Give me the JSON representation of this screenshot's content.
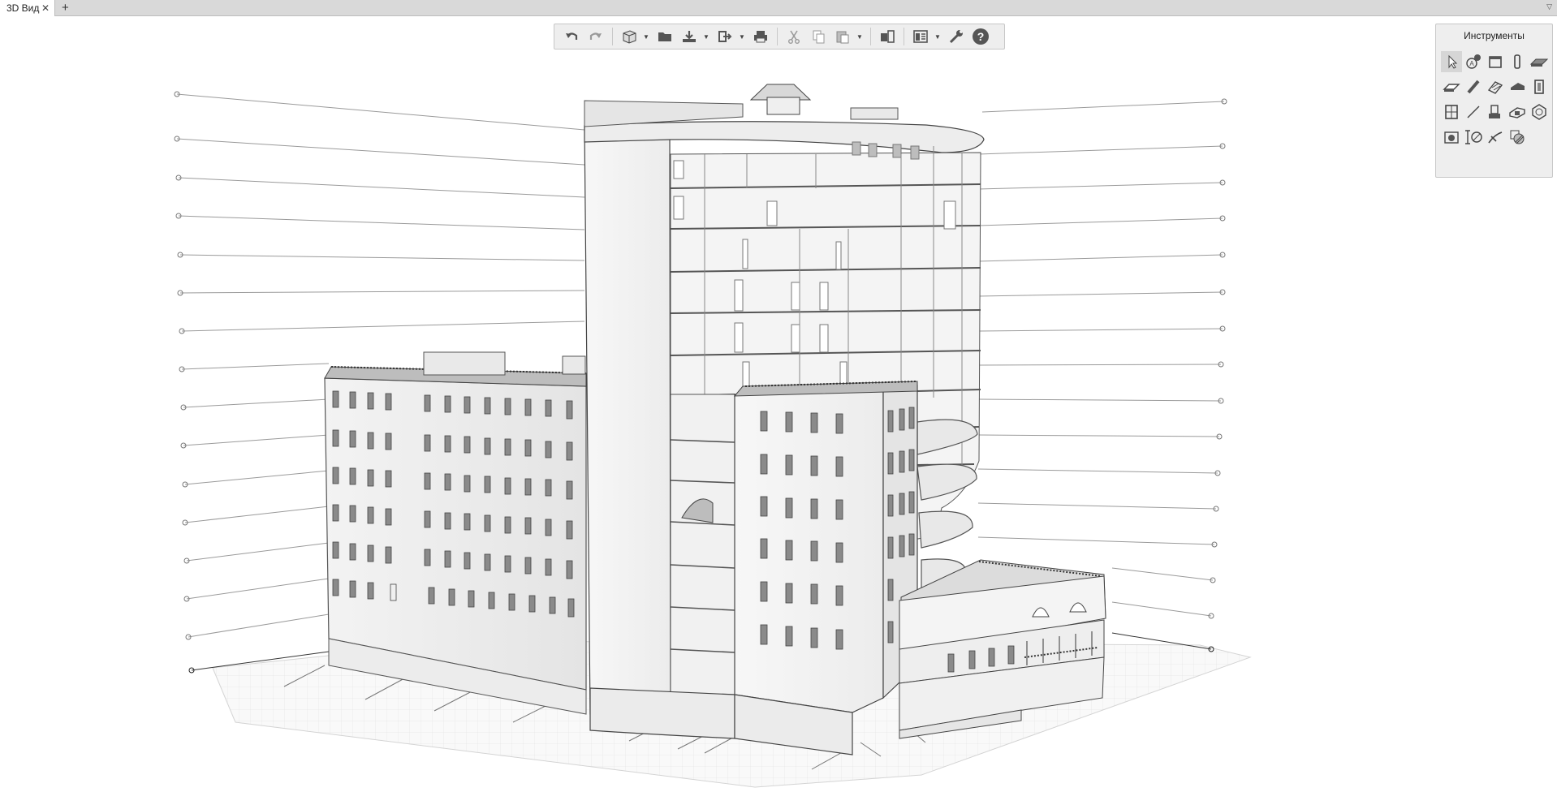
{
  "tabs": [
    {
      "label": "3D Вид",
      "close_glyph": "✕"
    }
  ],
  "add_tab_glyph": "+",
  "tools_panel": {
    "title": "Инструменты",
    "tools": [
      {
        "name": "select-tool-icon",
        "active": true
      },
      {
        "name": "annotation-tool-icon"
      },
      {
        "name": "panel-tool-icon"
      },
      {
        "name": "column-tool-icon"
      },
      {
        "name": "slab-tool-icon"
      },
      {
        "name": "beam-tool-icon"
      },
      {
        "name": "brace-tool-icon"
      },
      {
        "name": "stair-tool-icon"
      },
      {
        "name": "roof-tool-icon"
      },
      {
        "name": "door-tool-icon"
      },
      {
        "name": "window-tool-icon"
      },
      {
        "name": "line-tool-icon"
      },
      {
        "name": "foundation-tool-icon"
      },
      {
        "name": "opening-tool-icon"
      },
      {
        "name": "object-tool-icon"
      },
      {
        "name": "camera-tool-icon"
      },
      {
        "name": "dimension-tool-icon"
      },
      {
        "name": "section-line-tool-icon"
      },
      {
        "name": "hatch-tool-icon"
      }
    ]
  },
  "toolbar": {
    "groups": [
      [
        "undo-icon",
        "redo-icon"
      ],
      [
        "view-cube-icon",
        "open-folder-icon",
        "import-icon",
        "export-icon",
        "print-icon"
      ],
      [
        "cut-icon",
        "copy-icon",
        "paste-icon"
      ],
      [
        "layers-icon",
        "properties-icon"
      ],
      [
        "settings-wrench-icon",
        "help-icon"
      ]
    ]
  }
}
